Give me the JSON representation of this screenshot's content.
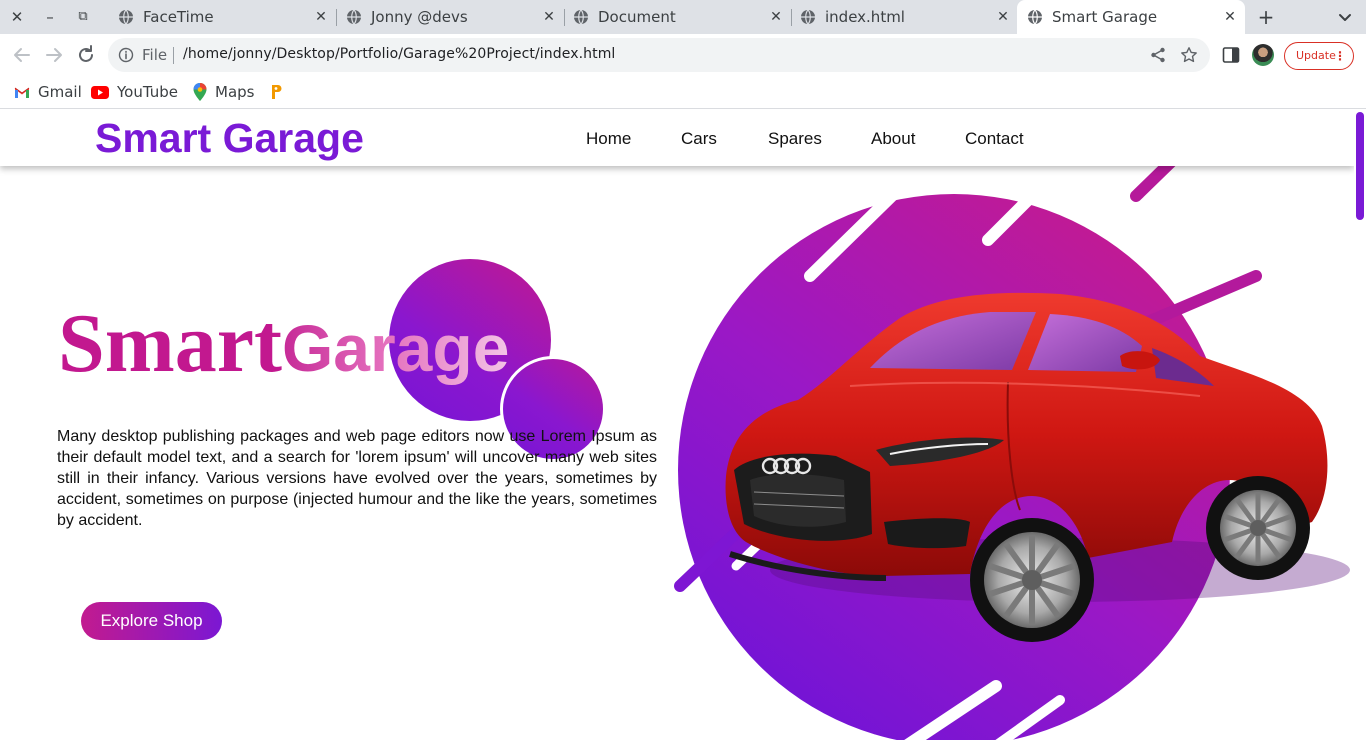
{
  "browser": {
    "window_controls": {
      "close": "✕",
      "minimize": "–",
      "restore": "⧉"
    },
    "tabs": [
      {
        "title": "FaceTime",
        "active": false
      },
      {
        "title": "Jonny @devs",
        "active": false
      },
      {
        "title": "Document",
        "active": false
      },
      {
        "title": "index.html",
        "active": false
      },
      {
        "title": "Smart Garage",
        "active": true
      }
    ],
    "tab_close_glyph": "✕",
    "new_tab_glyph": "+",
    "address_bar": {
      "scheme_label": "File",
      "url": "/home/jonny/Desktop/Portfolio/Garage%20Project/index.html"
    },
    "update_button": {
      "label": "Update",
      "menu_glyph": "⋮"
    },
    "bookmarks": [
      {
        "label": "Gmail",
        "icon": "gmail-icon"
      },
      {
        "label": "YouTube",
        "icon": "youtube-icon"
      },
      {
        "label": "Maps",
        "icon": "maps-icon"
      },
      {
        "label": "",
        "icon": "bookmark-app-icon"
      }
    ]
  },
  "site": {
    "brand": "Smart Garage",
    "nav": [
      "Home",
      "Cars",
      "Spares",
      "About",
      "Contact"
    ],
    "hero": {
      "title_part1": "Smart",
      "title_part2": "Garage",
      "paragraph": "Many desktop publishing packages and web page editors now use Lorem Ipsum as their default model text, and a search for 'lorem ipsum' will uncover many web sites still in their infancy. Various versions have evolved over the years, sometimes by accident, sometimes on purpose (injected humour and the like the years, sometimes by accident.",
      "cta_label": "Explore Shop",
      "image": "red-sports-car-image"
    },
    "colors": {
      "brand_purple": "#7a1ad6",
      "magenta": "#c2188f",
      "car_red": "#c81414"
    }
  }
}
